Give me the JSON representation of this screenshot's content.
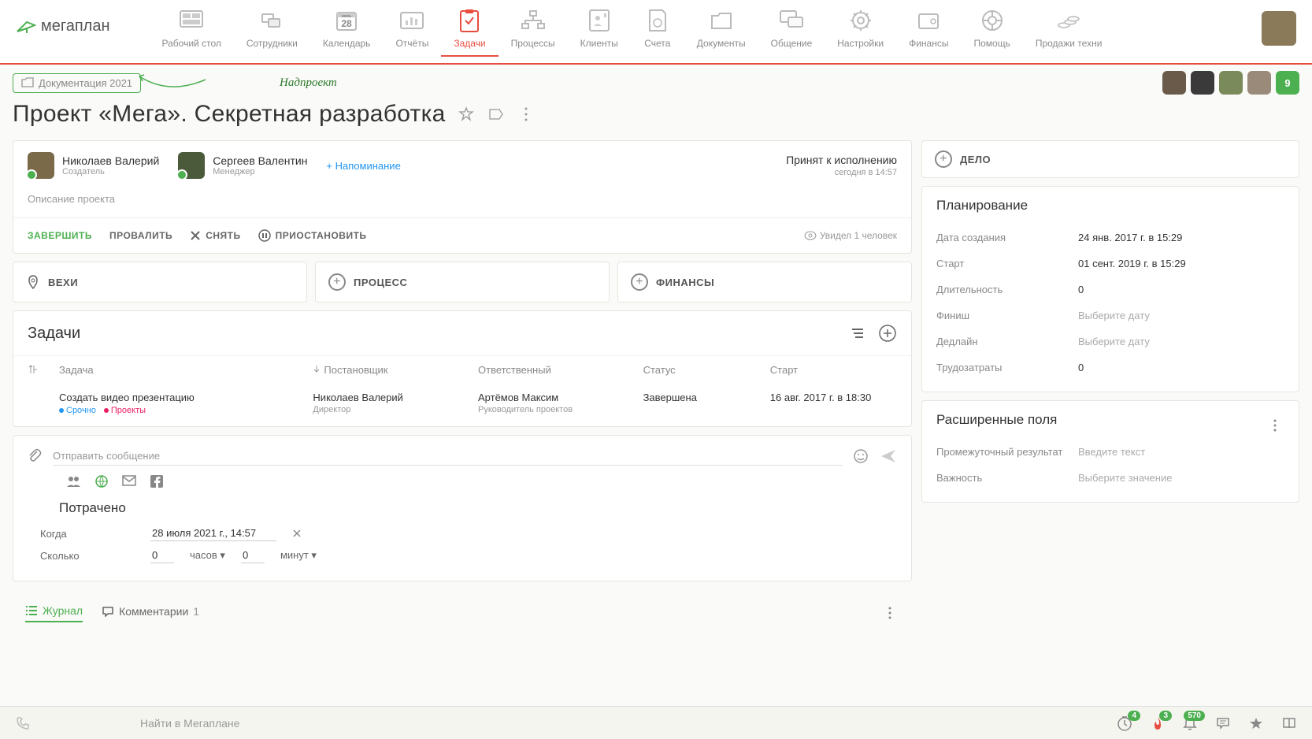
{
  "logo": "мегаплан",
  "nav": [
    {
      "label": "Рабочий стол"
    },
    {
      "label": "Сотрудники"
    },
    {
      "label": "Календарь",
      "day": "28",
      "month": "июль"
    },
    {
      "label": "Отчёты"
    },
    {
      "label": "Задачи"
    },
    {
      "label": "Процессы"
    },
    {
      "label": "Клиенты"
    },
    {
      "label": "Счета"
    },
    {
      "label": "Документы"
    },
    {
      "label": "Общение"
    },
    {
      "label": "Настройки"
    },
    {
      "label": "Финансы"
    },
    {
      "label": "Помощь"
    },
    {
      "label": "Продажи техни"
    }
  ],
  "breadcrumb": "Документация 2021",
  "annotation": "Надпроект",
  "participants_badge": "9",
  "title": "Проект «Мега». Секретная разработка",
  "creator": {
    "name": "Николаев Валерий",
    "role": "Создатель"
  },
  "manager": {
    "name": "Сергеев Валентин",
    "role": "Менеджер"
  },
  "reminder": "+ Напоминание",
  "status": {
    "text": "Принят к исполнению",
    "time": "сегодня в 14:57"
  },
  "description_ph": "Описание проекта",
  "actions": {
    "complete": "ЗАВЕРШИТЬ",
    "fail": "ПРОВАЛИТЬ",
    "remove": "СНЯТЬ",
    "pause": "ПРИОСТАНОВИТЬ"
  },
  "seen": "Увидел 1 человек",
  "three": {
    "milestones": "ВЕХИ",
    "process": "ПРОЦЕСС",
    "finances": "ФИНАНСЫ"
  },
  "tasks_title": "Задачи",
  "task_cols": {
    "task": "Задача",
    "assigner": "Постановщик",
    "responsible": "Ответственный",
    "status": "Статус",
    "start": "Старт"
  },
  "task": {
    "title": "Создать видео презентацию",
    "tags": [
      {
        "name": "Срочно",
        "color": "#2196f3"
      },
      {
        "name": "Проекты",
        "color": "#e91e63"
      }
    ],
    "assigner": {
      "name": "Николаев Валерий",
      "role": "Директор"
    },
    "responsible": {
      "name": "Артёмов Максим",
      "role": "Руководитель проектов"
    },
    "status": "Завершена",
    "start": "16 авг. 2017 г. в 18:30"
  },
  "msg_ph": "Отправить сообщение",
  "spent": {
    "title": "Потрачено",
    "when_lbl": "Когда",
    "when_val": "28 июля 2021 г., 14:57",
    "how_lbl": "Сколько",
    "hours_val": "0",
    "hours_lbl": "часов",
    "min_val": "0",
    "min_lbl": "минут"
  },
  "tabs": {
    "journal": "Журнал",
    "comments": "Комментарии",
    "comments_cnt": "1"
  },
  "delo": "ДЕЛО",
  "planning": {
    "title": "Планирование",
    "rows": [
      {
        "k": "Дата создания",
        "v": "24 янв. 2017 г. в 15:29"
      },
      {
        "k": "Старт",
        "v": "01 сент. 2019 г. в 15:29"
      },
      {
        "k": "Длительность",
        "v": "0"
      },
      {
        "k": "Финиш",
        "v": "Выберите дату",
        "ph": true
      },
      {
        "k": "Дедлайн",
        "v": "Выберите дату",
        "ph": true
      },
      {
        "k": "Трудозатраты",
        "v": "0"
      }
    ]
  },
  "ext": {
    "title": "Расширенные поля",
    "rows": [
      {
        "k": "Промежуточный результат",
        "v": "Введите текст",
        "ph": true
      },
      {
        "k": "Важность",
        "v": "Выберите значение",
        "ph": true
      }
    ]
  },
  "footer": {
    "search_ph": "Найти в Мегаплане",
    "b1": "4",
    "b2": "3",
    "b3": "570"
  }
}
